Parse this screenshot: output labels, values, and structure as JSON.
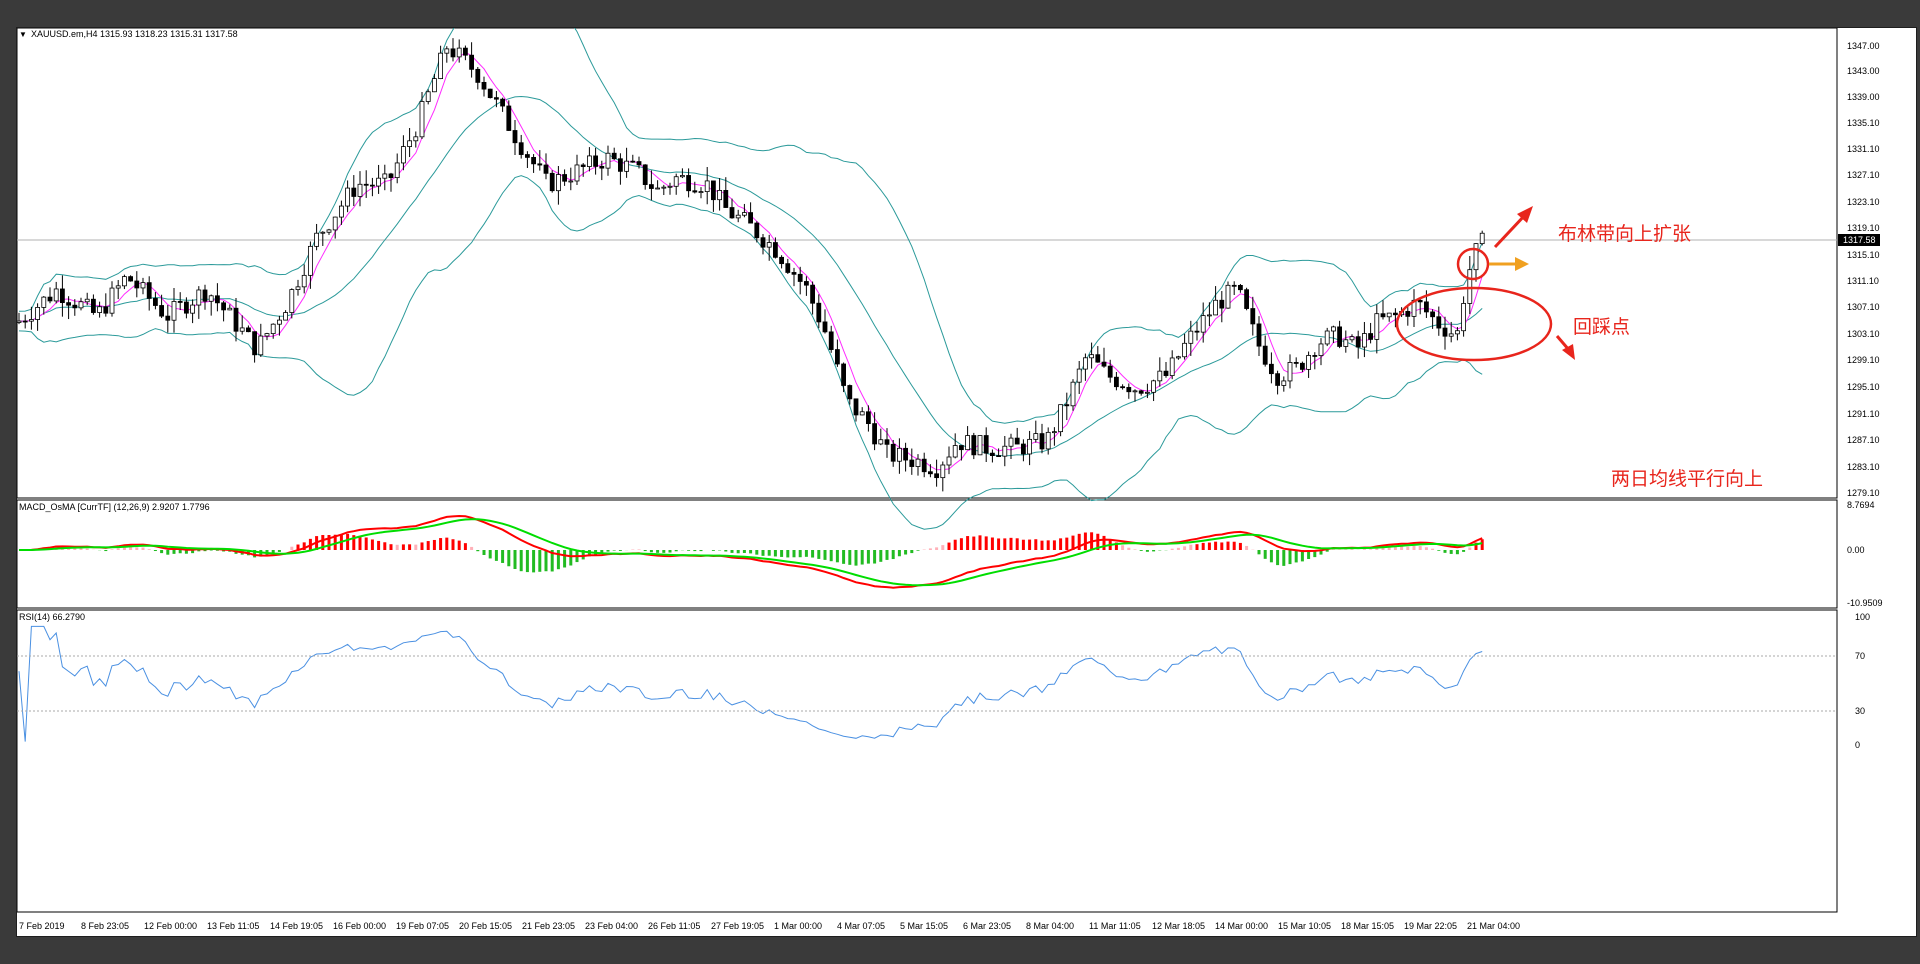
{
  "header": {
    "title": "XAUUSD.em,H4  1315.93 1318.23 1315.31 1317.58",
    "price_badge": "1317.58"
  },
  "price_axis": {
    "ticks": [
      "1347.00",
      "1343.00",
      "1339.00",
      "1335.10",
      "1331.10",
      "1327.10",
      "1323.10",
      "1319.10",
      "1315.10",
      "1311.10",
      "1307.10",
      "1303.10",
      "1299.10",
      "1295.10",
      "1291.10",
      "1287.10",
      "1283.10",
      "1279.10"
    ]
  },
  "macd_panel": {
    "title": "MACD_OsMA [CurrTF] (12,26,9) 2.9207 1.7796",
    "ticks": [
      "8.7694",
      "0.00",
      "-10.9509"
    ]
  },
  "rsi_panel": {
    "title": "RSI(14) 66.2790",
    "ticks": [
      "100",
      "70",
      "30",
      "0"
    ]
  },
  "time_axis": {
    "labels": [
      "7 Feb 2019",
      "8 Feb 23:05",
      "12 Feb 00:00",
      "13 Feb 11:05",
      "14 Feb 19:05",
      "16 Feb 00:00",
      "19 Feb 07:05",
      "20 Feb 15:05",
      "21 Feb 23:05",
      "23 Feb 04:00",
      "26 Feb 11:05",
      "27 Feb 19:05",
      "1 Mar 00:00",
      "4 Mar 07:05",
      "5 Mar 15:05",
      "6 Mar 23:05",
      "8 Mar 04:00",
      "11 Mar 11:05",
      "12 Mar 18:05",
      "14 Mar 00:00",
      "15 Mar 10:05",
      "18 Mar 15:05",
      "19 Mar 22:05",
      "21 Mar 04:00"
    ]
  },
  "annotations": {
    "bollinger_expand": "布林带向上扩张",
    "pullback_point": "回踩点",
    "ma_parallel_up": "两日均线平行向上"
  },
  "colors": {
    "bollinger": "#2b9a9a",
    "ma": "#ff2bff",
    "macd_line": "#ff0000",
    "signal_line": "#00dd00",
    "hist_up": "#ff0000",
    "hist_up_weak": "#ffb0b8",
    "hist_down": "#22bb22",
    "rsi_line": "#4a90e2",
    "annotation": "#e8251c",
    "arrow_orange": "#f0a020"
  }
}
